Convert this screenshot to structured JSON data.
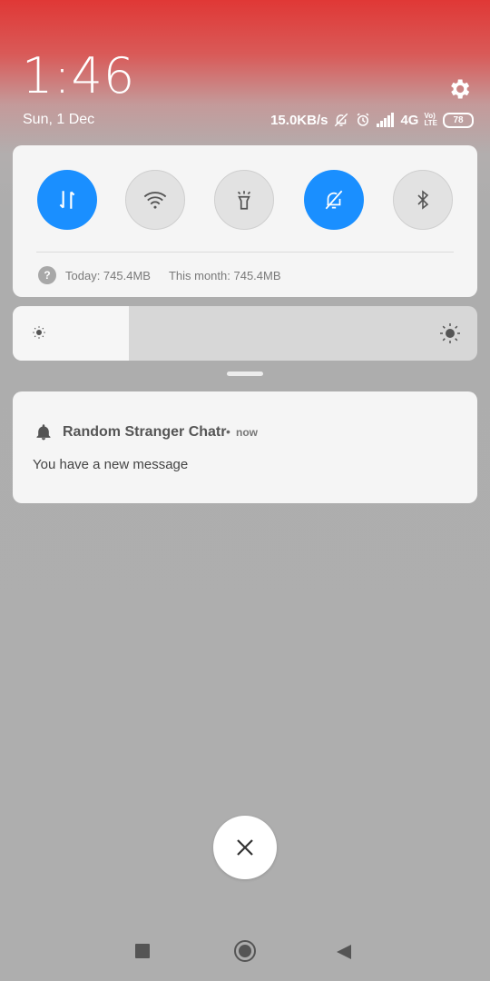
{
  "clock": {
    "time": "1:46",
    "date": "Sun, 1 Dec"
  },
  "status_bar": {
    "net_speed": "15.0KB/s",
    "network_type": "4G",
    "lte_top": "Vo)",
    "lte_bottom": "LTE",
    "battery": "78",
    "icons": [
      "mute-icon",
      "alarm-icon",
      "signal-icon",
      "battery-icon"
    ]
  },
  "quick_settings": {
    "toggles": [
      {
        "name": "mobile-data",
        "icon": "data-arrows-icon",
        "state": "on"
      },
      {
        "name": "wifi",
        "icon": "wifi-icon",
        "state": "off"
      },
      {
        "name": "flashlight",
        "icon": "flashlight-icon",
        "state": "off"
      },
      {
        "name": "silent",
        "icon": "mute-bell-icon",
        "state": "on"
      },
      {
        "name": "bluetooth",
        "icon": "bluetooth-icon",
        "state": "off"
      }
    ],
    "usage_today": "Today: 745.4MB",
    "usage_month": "This month: 745.4MB"
  },
  "brightness": {
    "level": 0.25
  },
  "notification": {
    "app_name": "Random Stranger Chatr",
    "separator": "•",
    "time": "now",
    "message": "You have a new message"
  },
  "colors": {
    "accent": "#1a8fff",
    "header_red": "#e03836"
  }
}
